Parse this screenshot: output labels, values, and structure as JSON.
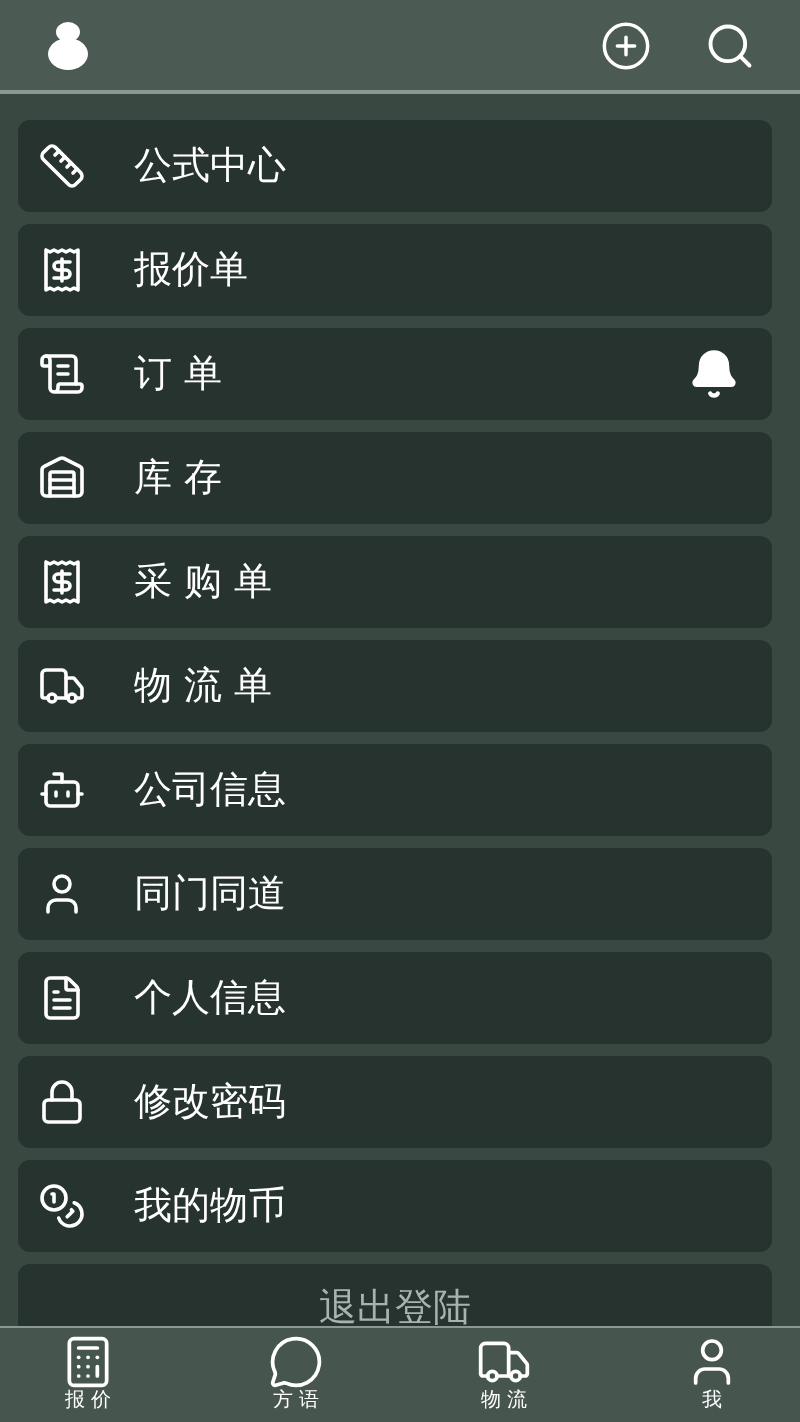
{
  "menu": [
    {
      "label": "公式中心",
      "bell": false
    },
    {
      "label": "报价单",
      "bell": false
    },
    {
      "label": "订 单",
      "bell": true
    },
    {
      "label": "库 存",
      "bell": false
    },
    {
      "label": "采 购 单",
      "bell": false
    },
    {
      "label": "物 流 单",
      "bell": false
    },
    {
      "label": "公司信息",
      "bell": false
    },
    {
      "label": "同门同道",
      "bell": false
    },
    {
      "label": "个人信息",
      "bell": false
    },
    {
      "label": "修改密码",
      "bell": false
    },
    {
      "label": "我的物币",
      "bell": false
    }
  ],
  "logout": "退出登陆",
  "tabs": [
    {
      "label": "报 价"
    },
    {
      "label": "方 语"
    },
    {
      "label": "物 流"
    },
    {
      "label": "我"
    }
  ]
}
